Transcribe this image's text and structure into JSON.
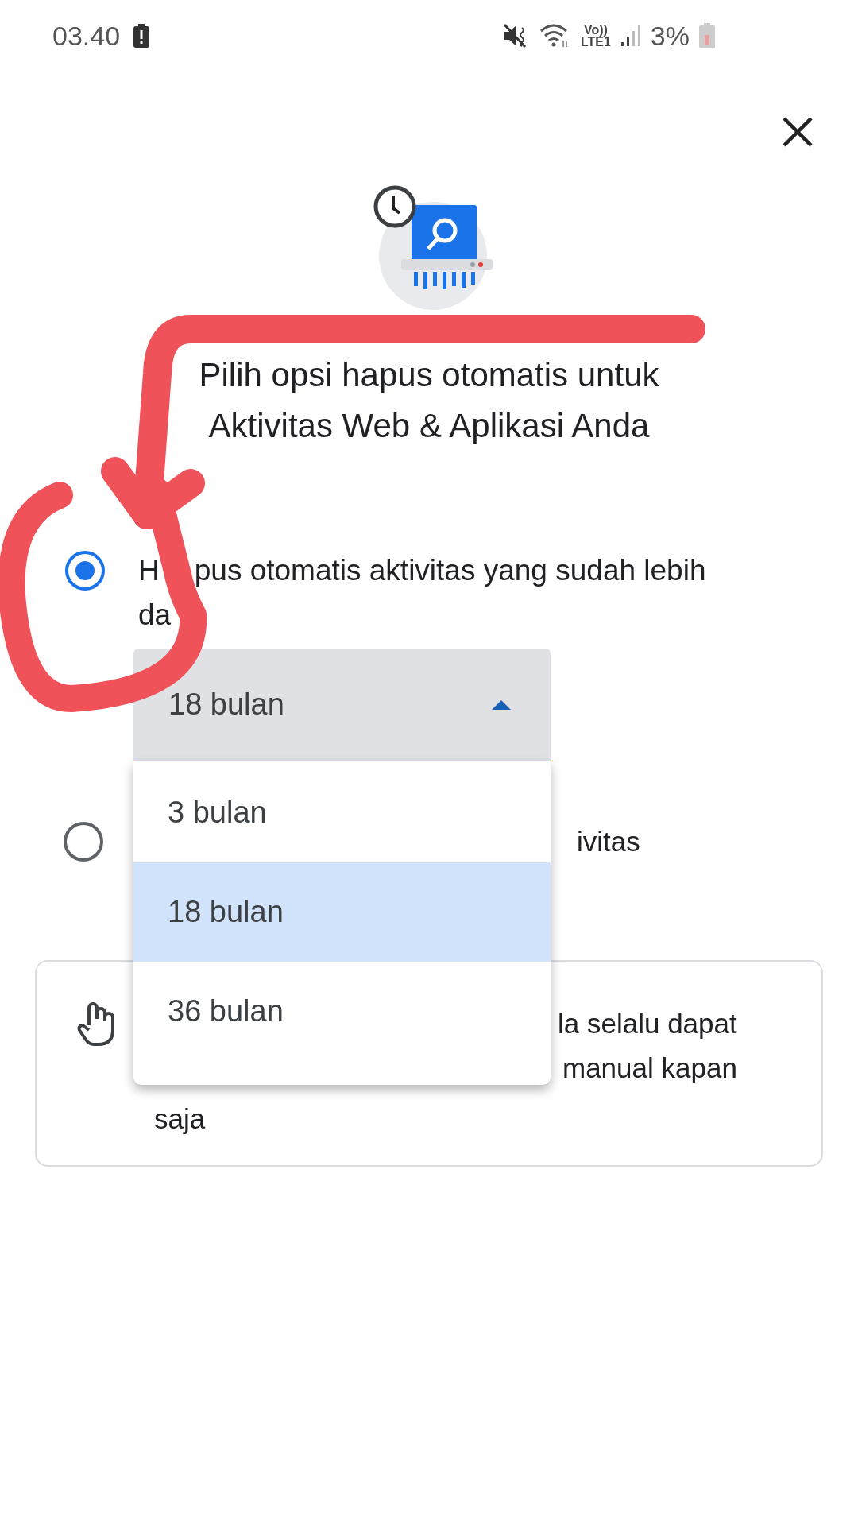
{
  "status_bar": {
    "time": "03.40",
    "network": "Vo))\nLTE1",
    "battery": "3%"
  },
  "title": "Pilih opsi hapus otomatis untuk Aktivitas Web & Aplikasi Anda",
  "options": [
    {
      "label_parts": [
        "H",
        "pus otomatis aktivitas yang sudah lebih",
        "da"
      ],
      "selected": true
    },
    {
      "label": "ivitas",
      "selected": false
    }
  ],
  "dropdown": {
    "value": "18 bulan",
    "expanded": true,
    "items": [
      {
        "label": "3 bulan",
        "selected": false
      },
      {
        "label": "18 bulan",
        "selected": true
      },
      {
        "label": "36 bulan",
        "selected": false
      }
    ]
  },
  "info_card": {
    "lines": [
      "la selalu dapat",
      "manual kapan",
      "saja"
    ]
  }
}
